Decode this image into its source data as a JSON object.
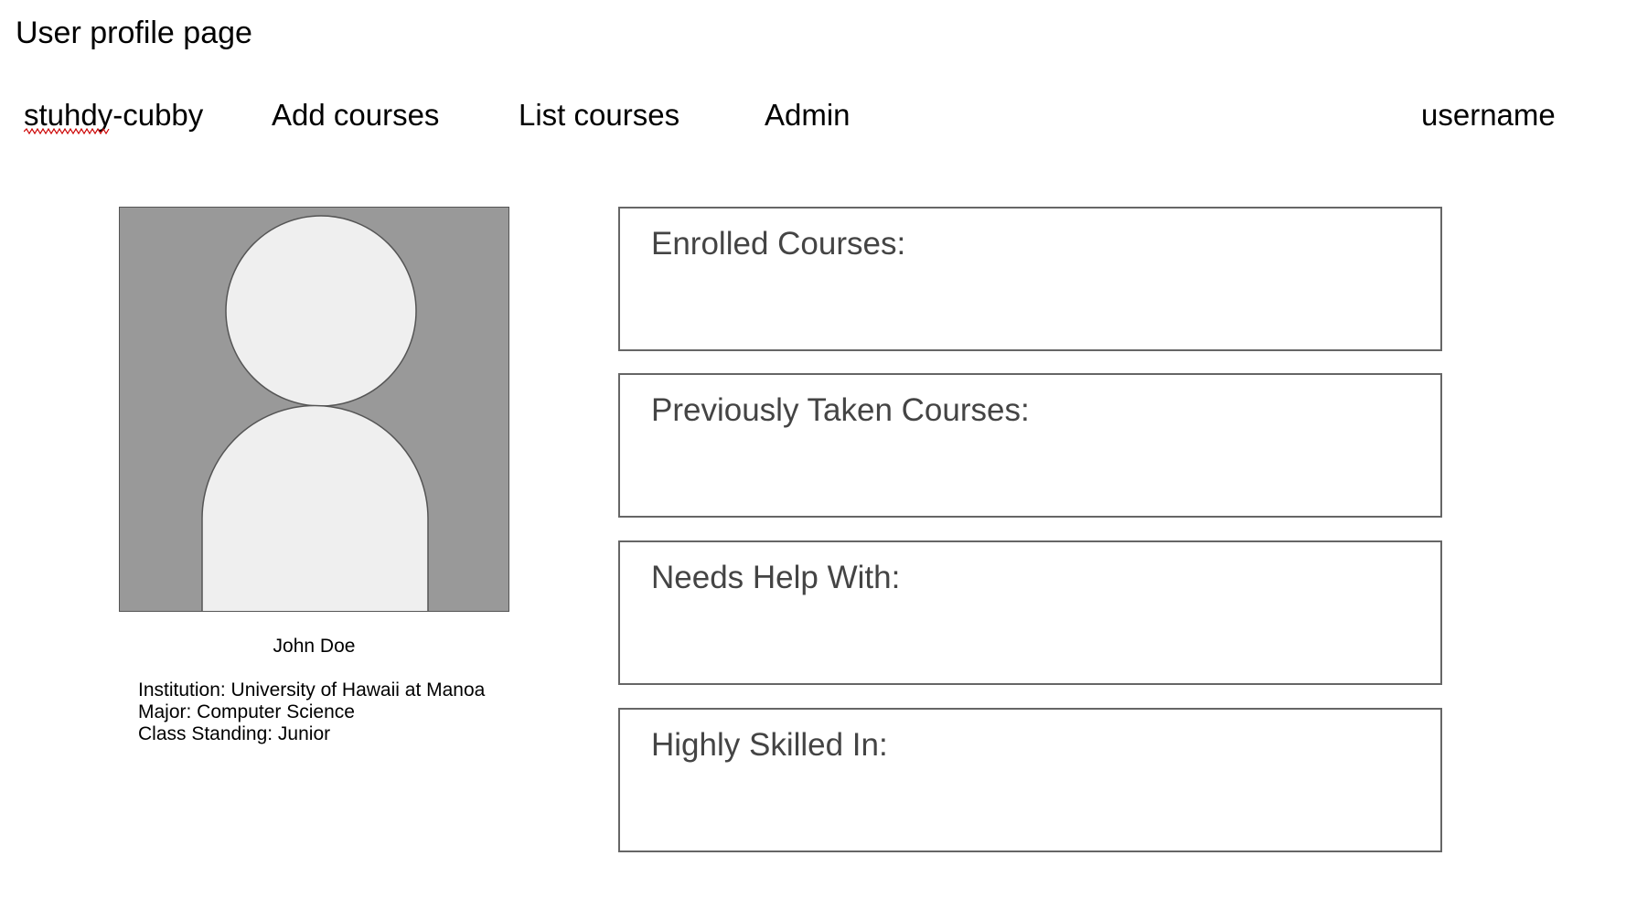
{
  "page": {
    "title": "User profile page"
  },
  "nav": {
    "brand": "stuhdy-cubby",
    "items": [
      {
        "label": "Add courses"
      },
      {
        "label": "List courses"
      },
      {
        "label": "Admin"
      }
    ],
    "user": "username"
  },
  "profile": {
    "avatar_icon": "user-silhouette-icon",
    "name": "John Doe",
    "details": [
      "Institution: University of Hawaii at Manoa",
      "Major: Computer Science",
      "Class Standing: Junior"
    ]
  },
  "sections": [
    {
      "title": "Enrolled Courses:"
    },
    {
      "title": "Previously Taken Courses:"
    },
    {
      "title": "Needs Help With:"
    },
    {
      "title": "Highly Skilled In:"
    }
  ],
  "colors": {
    "avatar_background": "#999999",
    "avatar_figure": "#efefef",
    "box_border": "#666666",
    "section_text": "#444444",
    "spellcheck_underline": "#cc0000"
  }
}
